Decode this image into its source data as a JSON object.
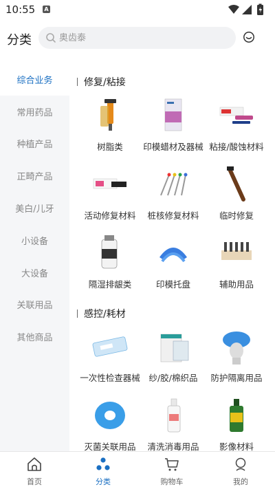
{
  "status_bar": {
    "time": "10:55",
    "notification_badge": "A"
  },
  "header": {
    "title": "分类",
    "search_placeholder": "奥齿泰",
    "service_icon": "customer-service-icon"
  },
  "sidebar": {
    "items": [
      {
        "label": "综合业务",
        "active": true
      },
      {
        "label": "常用药品",
        "active": false
      },
      {
        "label": "种植产品",
        "active": false
      },
      {
        "label": "正畸产品",
        "active": false
      },
      {
        "label": "美白/儿牙",
        "active": false
      },
      {
        "label": "小设备",
        "active": false
      },
      {
        "label": "大设备",
        "active": false
      },
      {
        "label": "关联用品",
        "active": false
      },
      {
        "label": "其他商品",
        "active": false
      }
    ]
  },
  "sections": [
    {
      "title": "修复/粘接",
      "items": [
        {
          "label": "树脂类"
        },
        {
          "label": "印模蜡材及器械"
        },
        {
          "label": "粘接/酸蚀材料"
        },
        {
          "label": "活动修复材料"
        },
        {
          "label": "桩核修复材料"
        },
        {
          "label": "临时修复"
        },
        {
          "label": "隔湿排龈类"
        },
        {
          "label": "印模托盘"
        },
        {
          "label": "辅助用品"
        }
      ]
    },
    {
      "title": "感控/耗材",
      "items": [
        {
          "label": "一次性检查器械"
        },
        {
          "label": "纱/胶/棉织品"
        },
        {
          "label": "防护隔离用品"
        },
        {
          "label": "灭菌关联用品"
        },
        {
          "label": "清洗消毒用品"
        },
        {
          "label": "影像材料"
        }
      ]
    }
  ],
  "tabbar": {
    "items": [
      {
        "label": "首页",
        "icon": "home-icon",
        "active": false
      },
      {
        "label": "分类",
        "icon": "category-icon",
        "active": true
      },
      {
        "label": "购物车",
        "icon": "cart-icon",
        "active": false
      },
      {
        "label": "我的",
        "icon": "profile-icon",
        "active": false
      }
    ]
  },
  "colors": {
    "accent": "#1a6fc2",
    "sidebar_bg": "#f5f6f8",
    "search_bg": "#f1f2f4"
  }
}
